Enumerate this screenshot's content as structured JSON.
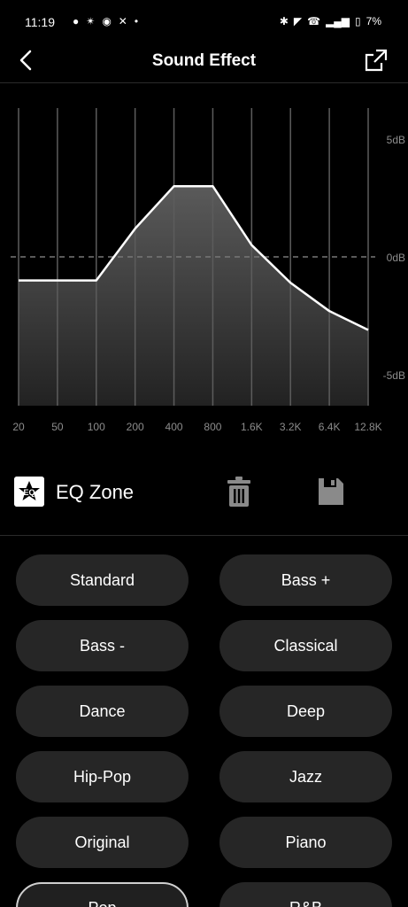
{
  "status": {
    "time": "11:19",
    "battery": "7%"
  },
  "header": {
    "title": "Sound Effect"
  },
  "eq": {
    "db_labels": [
      "5dB",
      "0dB",
      "-5dB"
    ],
    "freq_labels": [
      "20",
      "50",
      "100",
      "200",
      "400",
      "800",
      "1.6K",
      "3.2K",
      "6.4K",
      "12.8K"
    ],
    "gains_db": [
      -1.0,
      -1.0,
      -1.0,
      1.2,
      3.0,
      3.0,
      0.5,
      -1.1,
      -2.3,
      -3.1
    ],
    "ylim": [
      -5,
      5
    ]
  },
  "zone": {
    "label": "EQ Zone"
  },
  "presets": [
    {
      "label": "Standard",
      "selected": false
    },
    {
      "label": "Bass +",
      "selected": false
    },
    {
      "label": "Bass -",
      "selected": false
    },
    {
      "label": "Classical",
      "selected": false
    },
    {
      "label": "Dance",
      "selected": false
    },
    {
      "label": "Deep",
      "selected": false
    },
    {
      "label": "Hip-Pop",
      "selected": false
    },
    {
      "label": "Jazz",
      "selected": false
    },
    {
      "label": "Original",
      "selected": false
    },
    {
      "label": "Piano",
      "selected": false
    },
    {
      "label": "Pop",
      "selected": true
    },
    {
      "label": "R&B",
      "selected": false
    }
  ],
  "colors": {
    "background": "#000000",
    "button": "#262626",
    "curve": "#ffffff"
  }
}
